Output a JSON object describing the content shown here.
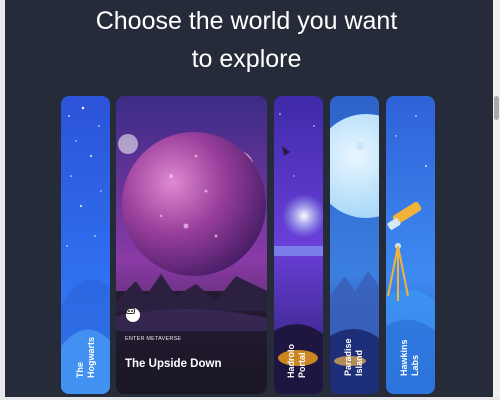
{
  "page": {
    "heading_line1": "Choose the world you want",
    "heading_line2": "to explore"
  },
  "worlds": [
    {
      "name": "The\nHogwarts",
      "theme": "night-sky-blue"
    },
    {
      "name": "The Upside Down",
      "tag": "ENTER METAVERSE",
      "theme": "purple-planet",
      "expanded": true
    },
    {
      "name": "Hadrolo\nPortal",
      "theme": "purple-portal"
    },
    {
      "name": "Paradise\nIsland",
      "theme": "moon-ocean"
    },
    {
      "name": "Hawkins\nLabs",
      "theme": "telescope-blue"
    }
  ],
  "icons": {
    "enter_icon": "vr-headset-icon"
  },
  "colors": {
    "background": "#252b38",
    "heading": "#ffffff"
  }
}
